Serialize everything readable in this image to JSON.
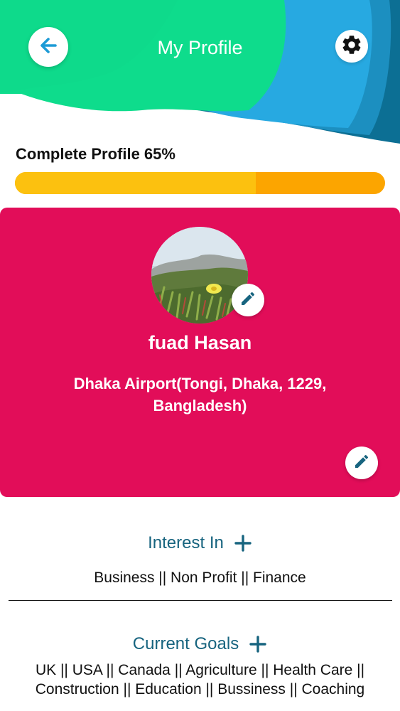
{
  "header": {
    "title": "My Profile",
    "back_icon": "arrow-left-icon",
    "settings_icon": "gear-icon",
    "colors": {
      "wave_green": "#0edc8c",
      "wave_blue": "#27a9e1",
      "wave_dark": "#0c6f94"
    }
  },
  "progress": {
    "label": "Complete Profile 65%",
    "percent": 65,
    "fill_color": "#fcc10f",
    "track_color": "#fca500"
  },
  "profile_card": {
    "background_color": "#e20d59",
    "name": "fuad Hasan",
    "address": "Dhaka Airport(Tongi, Dhaka, 1229, Bangladesh)",
    "avatar_edit_icon": "pencil-icon",
    "card_edit_icon": "pencil-icon"
  },
  "interest": {
    "title": "Interest In",
    "add_icon": "plus-icon",
    "value": "Business || Non Profit || Finance"
  },
  "goals": {
    "title": "Current Goals",
    "add_icon": "plus-icon",
    "value": "UK || USA || Canada || Agriculture || Health Care || Construction || Education || Bussiness || Coaching"
  }
}
